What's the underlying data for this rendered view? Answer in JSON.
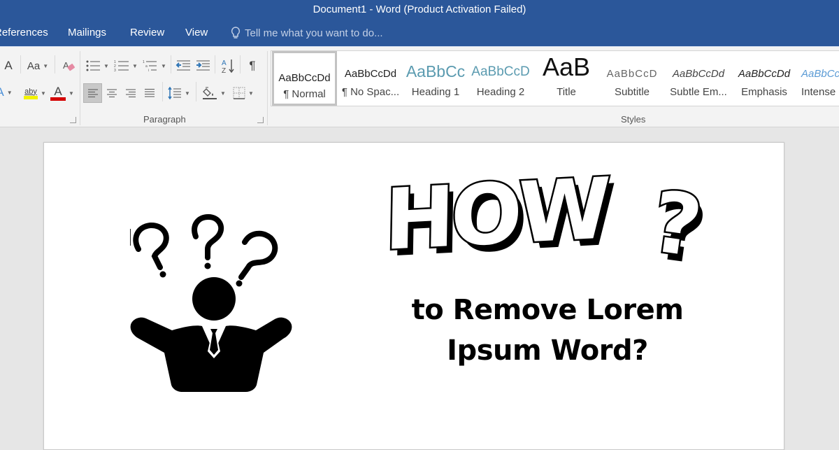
{
  "titlebar": {
    "title": "Document1 - Word (Product Activation Failed)"
  },
  "tabs": [
    {
      "label": "References"
    },
    {
      "label": "Mailings"
    },
    {
      "label": "Review"
    },
    {
      "label": "View"
    }
  ],
  "tell_me": {
    "placeholder": "Tell me what you want to do..."
  },
  "ribbon": {
    "font_group": {
      "grow_font": "A",
      "change_case": "Aa",
      "highlight_glyph": "aby",
      "font_color_glyph": "A",
      "highlight_color": "#f2f200",
      "font_color": "#d40000"
    },
    "paragraph_group": {
      "label": "Paragraph",
      "pilcrow": "¶",
      "sort_glyph": "A↓"
    },
    "styles_group": {
      "label": "Styles",
      "items": [
        {
          "sample": "AaBbCcDd",
          "name": "¶ Normal",
          "color": "#222222",
          "active": true
        },
        {
          "sample": "AaBbCcDd",
          "name": "¶ No Spac...",
          "color": "#222222"
        },
        {
          "sample": "AaBbCc",
          "name": "Heading 1",
          "color": "#5b9bb0"
        },
        {
          "sample": "AaBbCcD",
          "name": "Heading 2",
          "color": "#5b9bb0"
        },
        {
          "sample": "AaB",
          "name": "Title",
          "color": "#111111"
        },
        {
          "sample": "AaBbCcD",
          "name": "Subtitle",
          "color": "#666666"
        },
        {
          "sample": "AaBbCcDd",
          "name": "Subtle Em...",
          "color": "#444444"
        },
        {
          "sample": "AaBbCcDd",
          "name": "Emphasis",
          "color": "#222222"
        },
        {
          "sample": "AaBbCcDd",
          "name": "Intense",
          "color": "#5b9bd5"
        }
      ]
    }
  },
  "document": {
    "headline": "HOW",
    "headline_mark": "?",
    "subtitle_line1": "to Remove Lorem",
    "subtitle_line2": "Ipsum Word?"
  },
  "colors": {
    "accent": "#2b579a",
    "ribbon_bg": "#f3f3f3",
    "canvas_bg": "#e6e6e6"
  }
}
